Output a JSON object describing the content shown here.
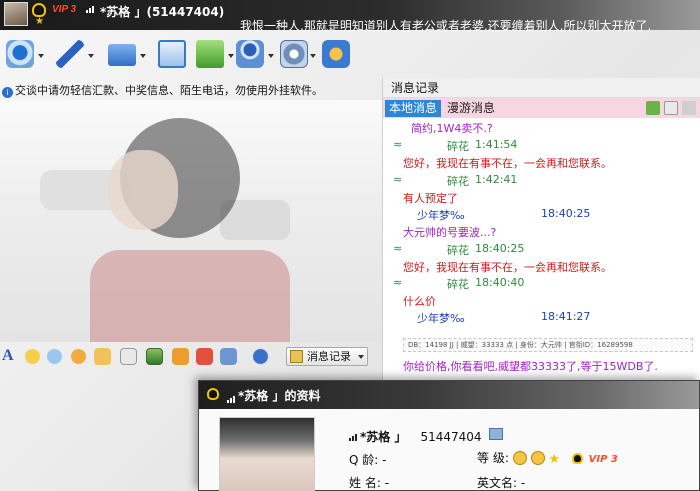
{
  "window": {
    "vip_label": "VIP 3",
    "title_name": "*苏格 」(51447404)",
    "signature": "我恨一种人,那就是明知道别人有老公或者老婆,还要缠着别人,所以别太开放了."
  },
  "warning": {
    "text": "交谈中请勿轻信汇款、中奖信息、陌生电话，勿使用外挂软件。"
  },
  "toolbar": {
    "icons": [
      "webcam-icon",
      "microphone-icon",
      "folder-icon",
      "screen-share-icon",
      "apps-icon",
      "multi-chat-icon",
      "settings-icon",
      "refresh-icon"
    ]
  },
  "edit_bar": {
    "font_label": "A",
    "message_record_label": "消息记录"
  },
  "record": {
    "header": "消息记录",
    "tab_local": "本地消息",
    "tab_roaming": "漫游消息",
    "lines": {
      "l0": "简约,1W4卖不.?",
      "l1_wave": "≈",
      "l1_name": "碎花",
      "l1_time": "1:41:54",
      "l2": "您好，我现在有事不在，一会再和您联系。",
      "l3_wave": "≈",
      "l3_name": "碎花",
      "l3_time": "1:42:41",
      "l4": "有人预定了",
      "l5_name": "少年梦‰",
      "l5_time": "18:40:25",
      "l6": "大元帅的号要波...?",
      "l7_wave": "≈",
      "l7_name": "碎花",
      "l7_time": "18:40:25",
      "l8": "您好，我现在有事不在，一会再和您联系。",
      "l9_wave": "≈",
      "l9_name": "碎花",
      "l9_time": "18:40:40",
      "l10": "什么价",
      "l11_name": "少年梦‰",
      "l11_time": "18:41:27",
      "info": "DB：14198 JJ | 威望：33333 点 | 身份：大元帅 | 官衔ID：16289598",
      "l12": "你给价格,你看看吧,威望都33333了,等于15WDB了."
    }
  },
  "profile": {
    "title": "*苏格 」的资料",
    "name": "*苏格 」",
    "qq_number": "51447404",
    "age_label": "Q   龄:",
    "age_value": "-",
    "level_label": "等   级:",
    "name_label": "姓   名:",
    "name_value": "-",
    "english_label": "英文名:",
    "english_value": "-",
    "vip_label": "VIP 3"
  }
}
